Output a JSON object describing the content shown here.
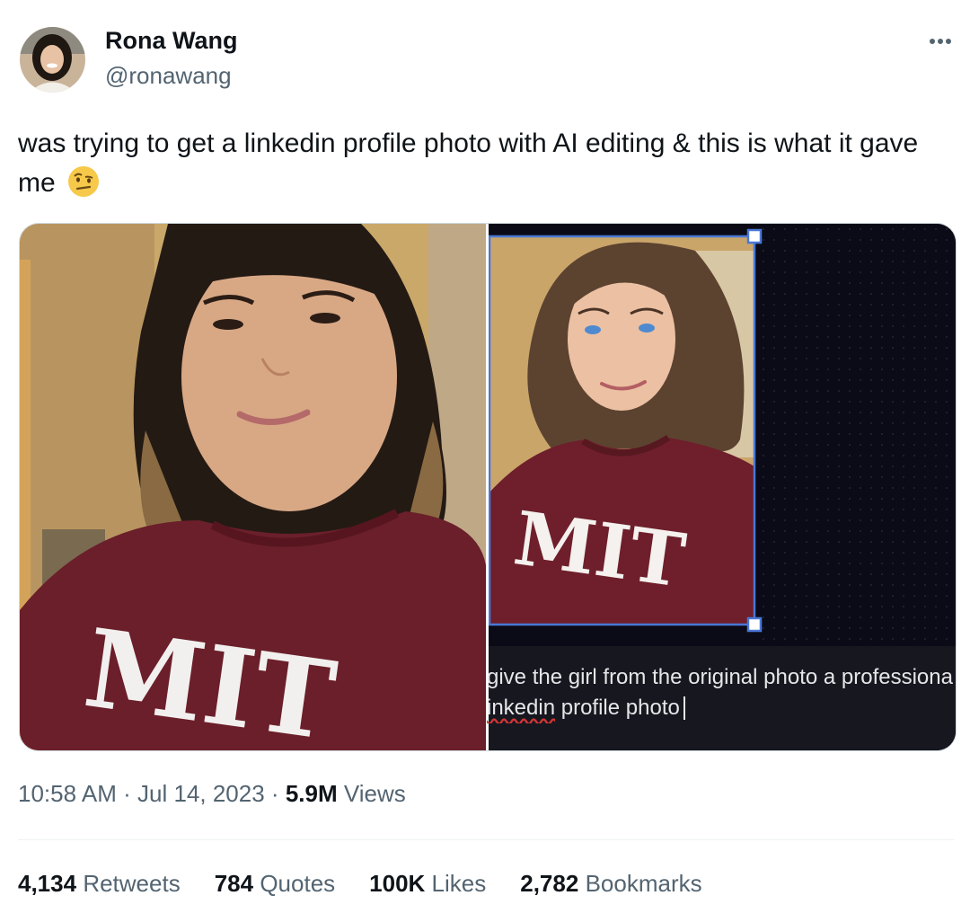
{
  "author": {
    "display_name": "Rona Wang",
    "handle": "@ronawang"
  },
  "tweet": {
    "text": "was trying to get a linkedin profile photo with AI editing & this is what it gave me",
    "emoji": "face-with-raised-eyebrow-emoji"
  },
  "media": {
    "left_image": "original-selfie-photo",
    "right_image": "ai-edited-photo",
    "shirt_text": "MIT",
    "prompt": {
      "line1": "give the girl from the original photo a professiona",
      "line2_misspelled": "inkedin",
      "line2_rest": "profile photo"
    }
  },
  "meta": {
    "time": "10:58 AM",
    "sep1": "·",
    "date": "Jul 14, 2023",
    "sep2": "·",
    "views_count": "5.9M",
    "views_label": "Views"
  },
  "stats": {
    "retweets_count": "4,134",
    "retweets_label": "Retweets",
    "quotes_count": "784",
    "quotes_label": "Quotes",
    "likes_count": "100K",
    "likes_label": "Likes",
    "bookmarks_count": "2,782",
    "bookmarks_label": "Bookmarks"
  },
  "colors": {
    "primary_text": "#0f1419",
    "secondary_text": "#536471",
    "maroon_shirt": "#6b1f2a",
    "selection_blue": "#4a78d6"
  }
}
